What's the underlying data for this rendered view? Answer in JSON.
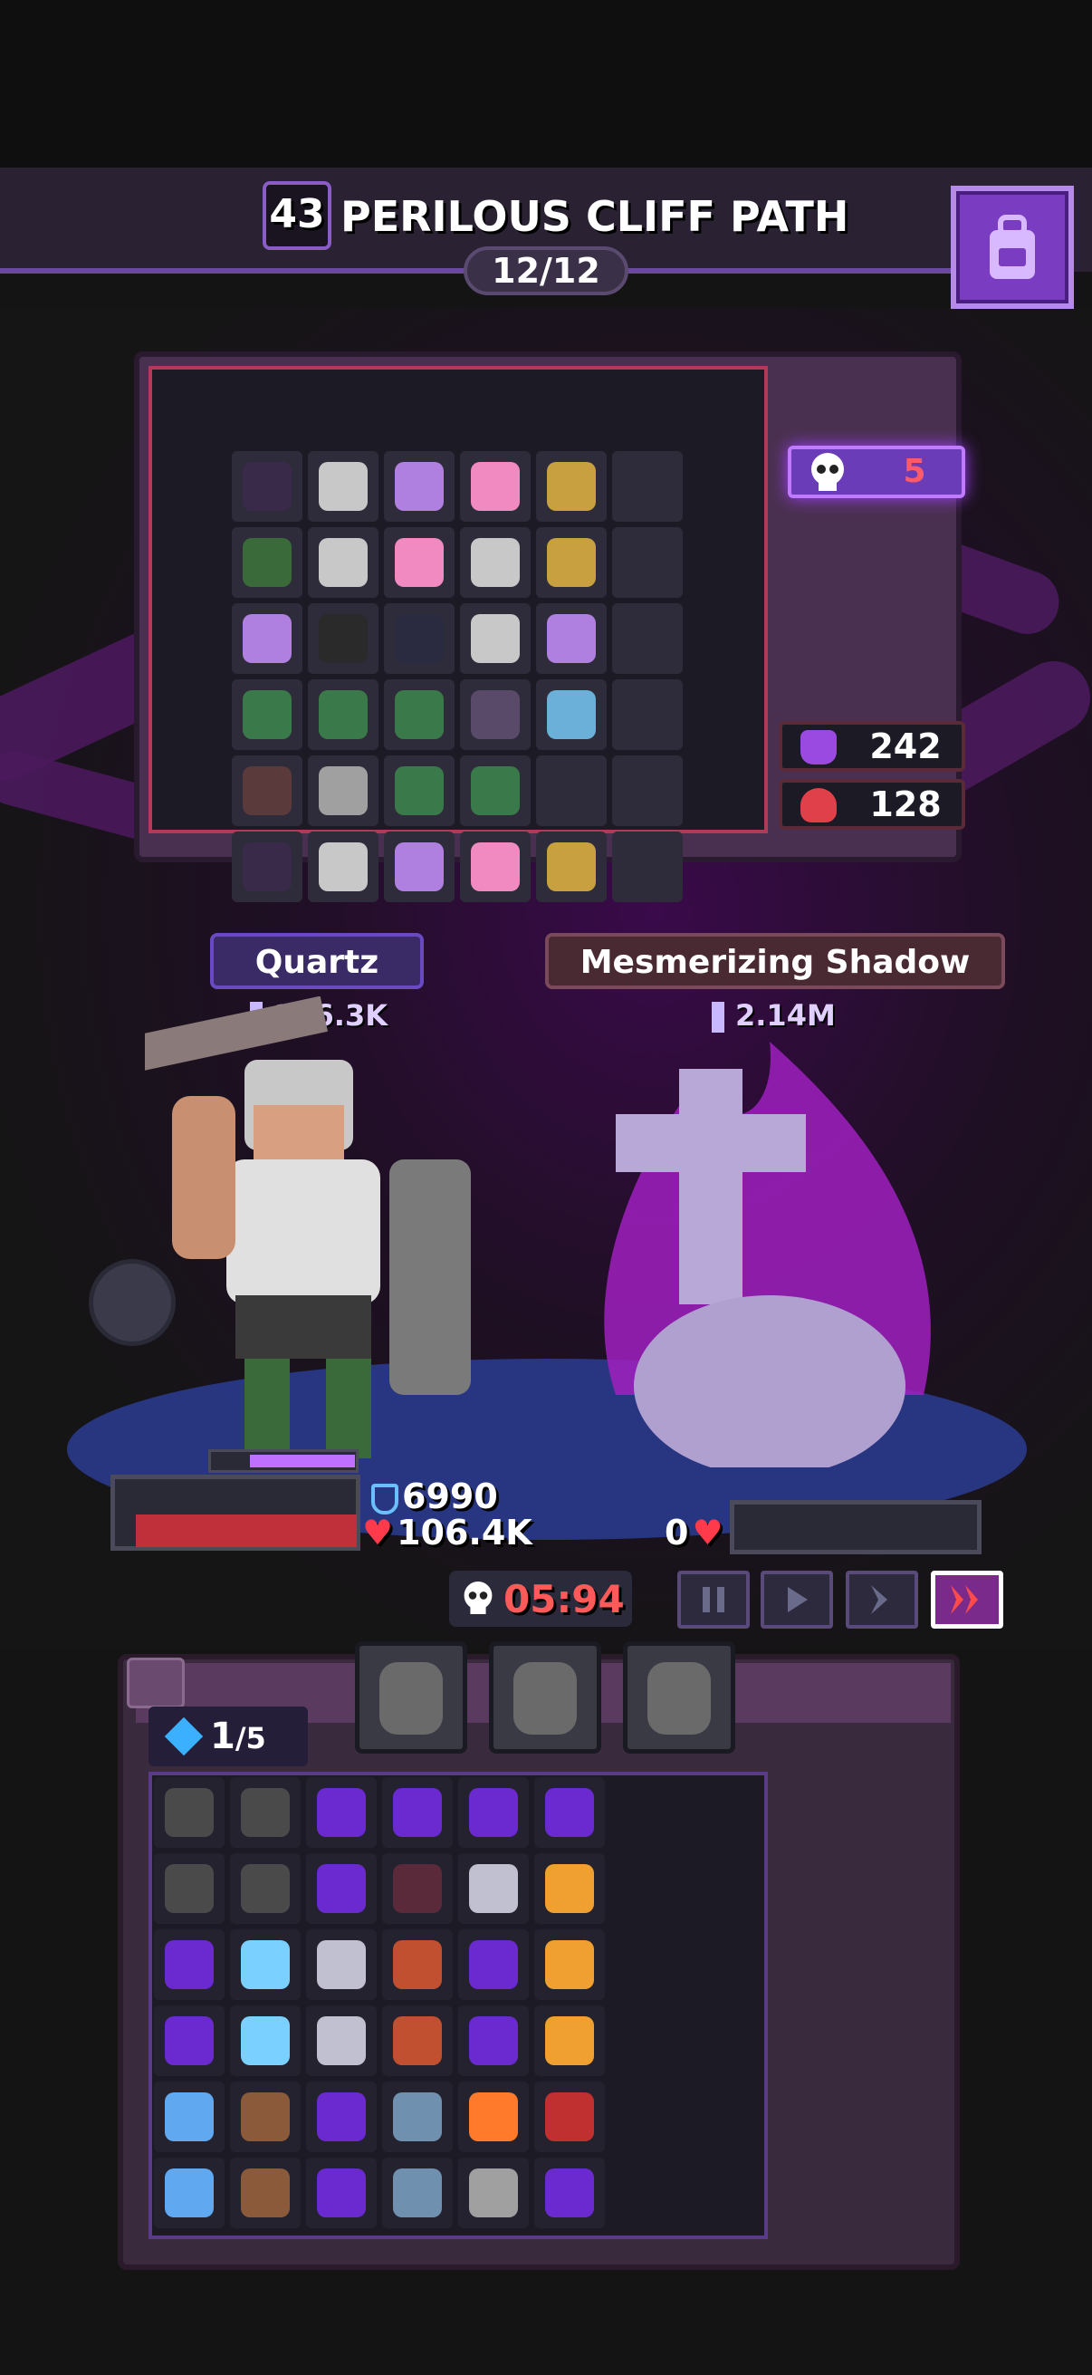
{
  "header": {
    "level": "43",
    "title": "PERILOUS CLIFF PATH",
    "wave": "12/12"
  },
  "loot_panel": {
    "kills": "5",
    "stat_purple": "242",
    "stat_red": "128"
  },
  "battle": {
    "hero": {
      "name": "Quartz",
      "power": "136.3K",
      "armor": "6990",
      "hp": "106.4K"
    },
    "enemy": {
      "name": "Mesmerizing Shadow",
      "power": "2.14M",
      "hp": "0"
    },
    "timer": "05:94",
    "speed_controls": [
      "pause",
      "play",
      "fast",
      "fastest"
    ]
  },
  "inventory": {
    "gems": "1",
    "gems_max": "/5"
  },
  "colors": {
    "accent_purple": "#7a3cc0",
    "hp_red": "#c0303a",
    "timer_red": "#ff5a5a"
  }
}
